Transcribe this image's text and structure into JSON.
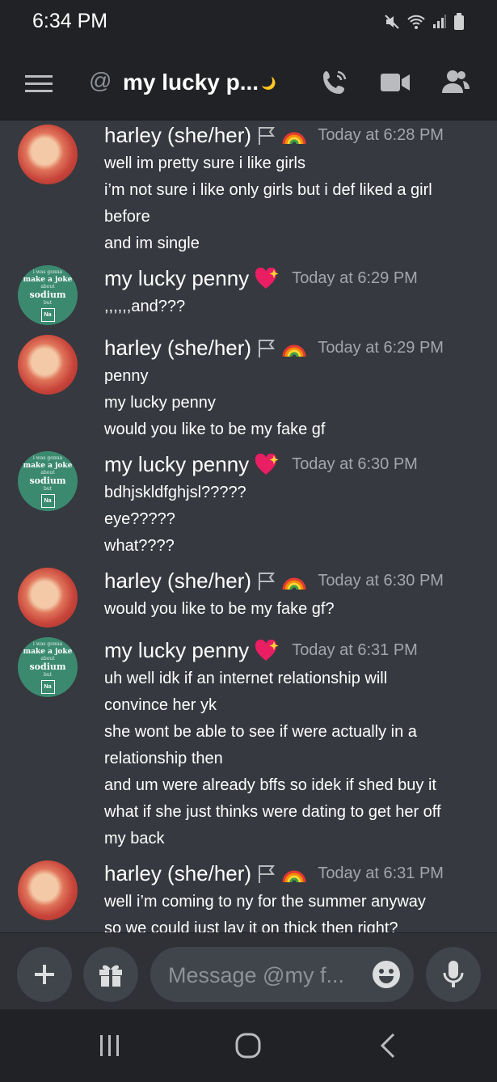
{
  "status": {
    "time": "6:34 PM"
  },
  "header": {
    "at_symbol": "@",
    "channel_name": "my lucky p...",
    "moon_emoji": "🌙"
  },
  "messages": [
    {
      "author": "harley (she/her)",
      "badge": "🏳️‍🌈",
      "timestamp": "Today at 6:28 PM",
      "avatar": "harley",
      "lines": [
        "well im pretty sure i like girls",
        "i’m not sure i like only girls but i def liked a girl",
        "before",
        "and im single"
      ]
    },
    {
      "author": "my lucky penny",
      "badge": "💖",
      "timestamp": "Today at 6:29 PM",
      "avatar": "penny",
      "lines": [
        ",,,,,,and???"
      ]
    },
    {
      "author": "harley (she/her)",
      "badge": "🏳️‍🌈",
      "timestamp": "Today at 6:29 PM",
      "avatar": "harley",
      "lines": [
        "penny",
        "my lucky penny",
        "would you like to be my fake gf"
      ]
    },
    {
      "author": "my lucky penny",
      "badge": "💖",
      "timestamp": "Today at 6:30 PM",
      "avatar": "penny",
      "lines": [
        "bdhjskldfghjsl?????",
        "eye?????",
        "what????"
      ]
    },
    {
      "author": "harley (she/her)",
      "badge": "🏳️‍🌈",
      "timestamp": "Today at 6:30 PM",
      "avatar": "harley",
      "lines": [
        "would you like to be my fake gf?"
      ]
    },
    {
      "author": "my lucky penny",
      "badge": "💖",
      "timestamp": "Today at 6:31 PM",
      "avatar": "penny",
      "lines": [
        "uh well idk if an internet relationship will",
        "convince her yk",
        "she wont be able to see if were actually in a",
        "relationship then",
        "and um were already bffs so idek if shed buy it",
        "what if she just thinks were dating to get her off",
        "my back"
      ]
    },
    {
      "author": "harley (she/her)",
      "badge": "🏳️‍🌈",
      "timestamp": "Today at 6:31 PM",
      "avatar": "harley",
      "lines": [
        "well i’m coming to ny for the summer anyway",
        "so we could just lay it on thick then right?"
      ]
    }
  ],
  "penny_avatar_text": {
    "line1": "i was gonna",
    "line2": "make a joke",
    "line3": "about",
    "line4": "sodium",
    "line5": "but",
    "symbol": "Na"
  },
  "composer": {
    "placeholder": "Message @my f..."
  },
  "icons": {
    "menu": "hamburger-icon",
    "at": "at-icon",
    "call": "phone-call-icon",
    "video": "video-camera-icon",
    "members": "members-icon",
    "add": "plus-icon",
    "gift": "gift-icon",
    "emoji": "emoji-icon",
    "mic": "microphone-icon",
    "nav_recent": "recent-apps-icon",
    "nav_home": "home-icon",
    "nav_back": "back-icon"
  },
  "colors": {
    "background": "#36393f",
    "header": "#202225",
    "input": "#40444b",
    "timestamp": "#a3a6aa",
    "text": "#ffffff"
  }
}
